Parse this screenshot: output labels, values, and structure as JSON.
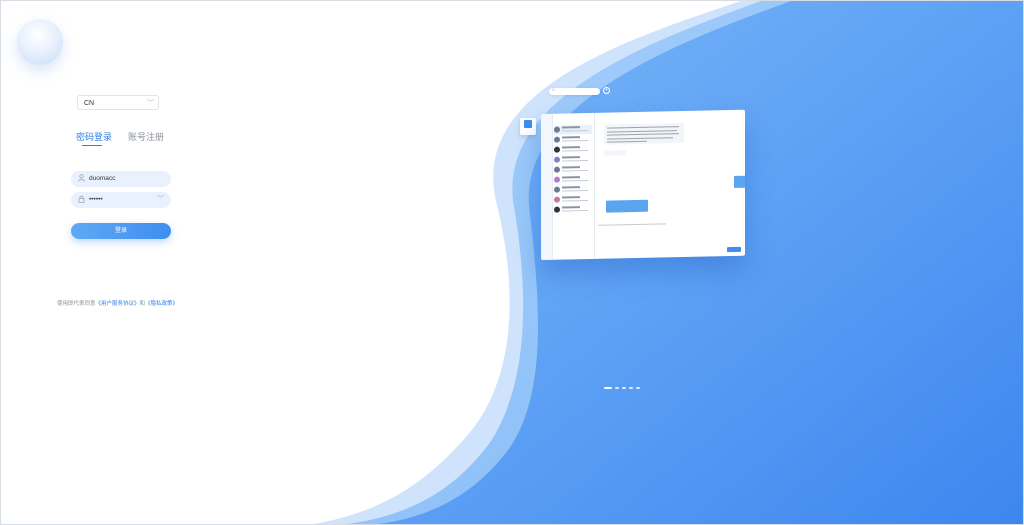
{
  "colors": {
    "accent": "#2f7fe6",
    "button_gradient_start": "#5ea9f5",
    "button_gradient_end": "#3e8ef0",
    "field_bg": "#e8f1fd",
    "background_blue": "#4a94f3"
  },
  "language_selector": {
    "value": "CN",
    "icon": "chevron-down-icon"
  },
  "tabs": [
    {
      "label": "密码登录",
      "active": true
    },
    {
      "label": "账号注册",
      "active": false
    }
  ],
  "form": {
    "username": {
      "value": "duomacc",
      "icon": "user-icon"
    },
    "password": {
      "value": "••••••",
      "icon": "lock-icon",
      "toggle_icon": "eye-closed-icon"
    },
    "submit_label": "登录"
  },
  "agreement": {
    "prefix": "使用即代表同意",
    "terms_link": "《用户服务协议》",
    "middle": "和",
    "privacy_link": "《隐私政策》"
  },
  "carousel": {
    "slide_count": 5,
    "active_index": 0
  }
}
